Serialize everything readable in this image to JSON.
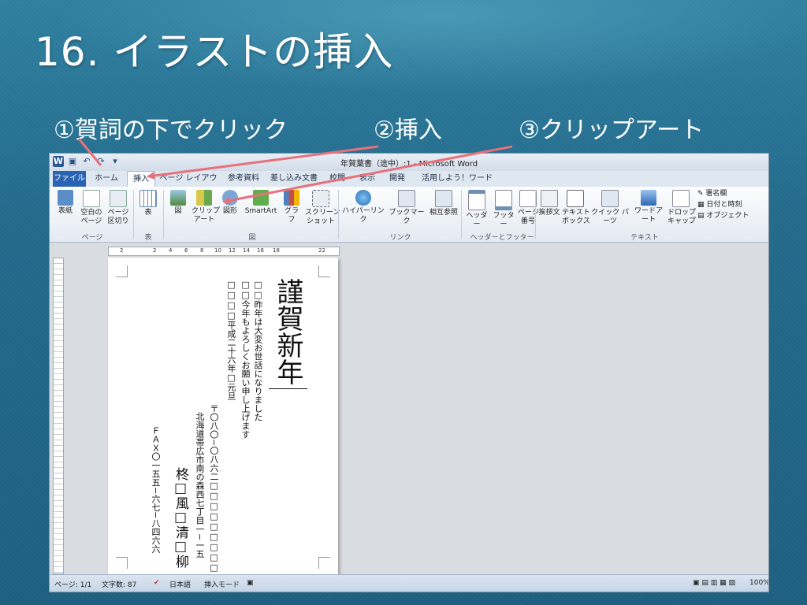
{
  "slide": {
    "title": "16. イラストの挿入",
    "steps": [
      "①賀詞の下でクリック",
      "②挿入",
      "③クリップアート"
    ]
  },
  "window": {
    "title": "年賀葉書（途中）:1 - Microsoft Word",
    "tabs": [
      "ファイル",
      "ホーム",
      "挿入",
      "ページ レイアウト",
      "参考資料",
      "差し込み文書",
      "校閲",
      "表示",
      "開発",
      "活用しよう！ワード"
    ],
    "active_tab": "挿入"
  },
  "ribbon": {
    "groups": {
      "page": "ページ",
      "table": "表",
      "illustrations": "図",
      "links": "リンク",
      "header_footer": "ヘッダーとフッター",
      "text": "テキスト"
    },
    "buttons": {
      "cover": "表紙",
      "blank_page": "空白の\nページ",
      "page_break": "ページ\n区切り",
      "table": "表",
      "picture": "図",
      "clipart": "クリップ\nアート",
      "shapes": "図形",
      "smartart": "SmartArt",
      "chart": "グラフ",
      "screenshot": "スクリーン\nショット",
      "hyperlink": "ハイパーリンク",
      "bookmark": "ブックマーク",
      "crossref": "相互参照",
      "header": "ヘッダー",
      "footer": "フッター",
      "page_number": "ページ\n番号",
      "greeting": "挨拶文",
      "textbox": "テキスト\nボックス",
      "quickparts": "クイック パーツ",
      "wordart": "ワードアート",
      "dropcap": "ドロップ\nキャップ",
      "signature": "署名欄",
      "datetime": "日付と時刻",
      "object": "オブジェクト"
    }
  },
  "ruler": [
    "2",
    "2",
    "4",
    "6",
    "8",
    "10",
    "12",
    "14",
    "16",
    "18",
    "22"
  ],
  "document": {
    "heading": "謹賀新年",
    "line1": "□□昨年は大変お世話になりました",
    "line2": "□□今年もよろしくお願い申し上げます",
    "line3": "□□□□平成二十六年□元旦",
    "postal": "〒〇八〇−〇八六二□□□□□□□□□",
    "address": "北海道帯広市南の森西七丁目一−一五",
    "name": "柊□風□清□柳",
    "fax": "ＦＡＸ〇一五五−六七−八四六六"
  },
  "status": {
    "page": "ページ: 1/1",
    "words": "文字数: 87",
    "lang": "日本語",
    "mode": "挿入モード",
    "zoom": "100%"
  },
  "colors": {
    "arrow": "#e8707a",
    "accent": "#2a62b4"
  }
}
